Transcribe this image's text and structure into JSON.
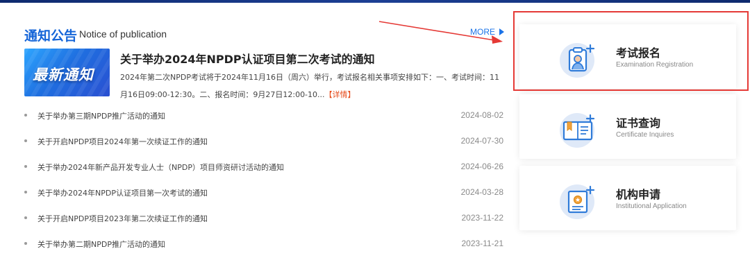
{
  "section": {
    "title": "通知公告",
    "subtitle": "Notice of publication",
    "more_label": "MORE"
  },
  "featured": {
    "thumb_text": "最新通知",
    "title": "关于举办2024年NPDP认证项目第二次考试的通知",
    "desc": "2024年第二次NPDP考试将于2024年11月16日（周六）举行，考试报名相关事项安排如下：一、考试时间：11月16日09:00-12:30。二、报名时间：9月27日12:00-10...",
    "detail_label": "【详情】"
  },
  "news": [
    {
      "title": "关于举办第三期NPDP推广活动的通知",
      "date": "2024-08-02"
    },
    {
      "title": "关于开启NPDP项目2024年第一次续证工作的通知",
      "date": "2024-07-30"
    },
    {
      "title": "关于举办2024年新产品开发专业人士（NPDP）项目师资研讨活动的通知",
      "date": "2024-06-26"
    },
    {
      "title": "关于举办2024年NPDP认证项目第一次考试的通知",
      "date": "2024-03-28"
    },
    {
      "title": "关于开启NPDP项目2023年第二次续证工作的通知",
      "date": "2023-11-22"
    },
    {
      "title": "关于举办第二期NPDP推广活动的通知",
      "date": "2023-11-21"
    }
  ],
  "cards": [
    {
      "zh": "考试报名",
      "en": "Examination Registration",
      "icon": "exam-registration-icon"
    },
    {
      "zh": "证书查询",
      "en": "Certificate Inquires",
      "icon": "certificate-query-icon"
    },
    {
      "zh": "机构申请",
      "en": "Institutional Application",
      "icon": "institution-application-icon"
    }
  ],
  "colors": {
    "accent": "#1565d8",
    "annotation_red": "#e53935",
    "detail_orange": "#e64a19",
    "icon_blue": "#2f7bd9"
  }
}
